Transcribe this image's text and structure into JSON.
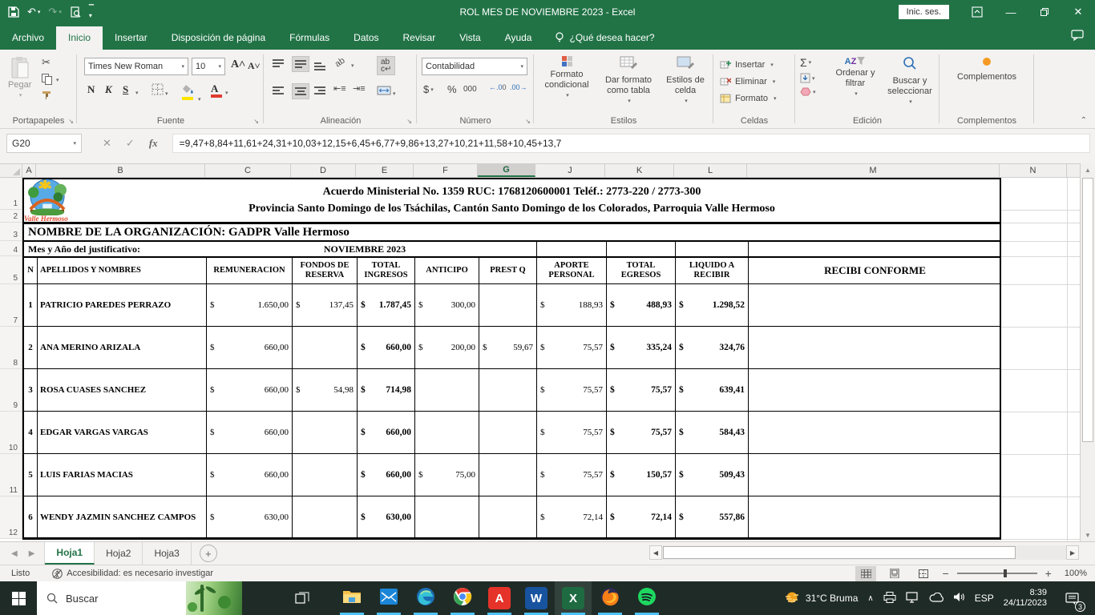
{
  "titlebar": {
    "title": "ROL MES DE NOVIEMBRE 2023  -  Excel",
    "sign_in": "Inic. ses."
  },
  "menu": {
    "tabs": [
      "Archivo",
      "Inicio",
      "Insertar",
      "Disposición de página",
      "Fórmulas",
      "Datos",
      "Revisar",
      "Vista",
      "Ayuda"
    ],
    "active_tab": "Inicio",
    "tell_me": "¿Qué desea hacer?"
  },
  "ribbon": {
    "paste_label": "Pegar",
    "clipboard_group": "Portapapeles",
    "font_name": "Times New Roman",
    "font_size": "10",
    "bold": "N",
    "italic": "K",
    "underline": "S",
    "font_group": "Fuente",
    "alignment_group": "Alineación",
    "number_format": "Contabilidad",
    "currency": "$",
    "percent": "%",
    "thousands": "000",
    "number_group": "Número",
    "conditional_format": "Formato condicional",
    "format_as_table": "Dar formato como tabla",
    "cell_styles": "Estilos de celda",
    "styles_group": "Estilos",
    "insert_label": "Insertar",
    "delete_label": "Eliminar",
    "format_label": "Formato",
    "cells_group": "Celdas",
    "sort_filter": "Ordenar y filtrar",
    "find_select": "Buscar y seleccionar",
    "editing_group": "Edición",
    "addins_button": "Complementos",
    "addins_group": "Complementos"
  },
  "formula_bar": {
    "cell_ref": "G20",
    "fx": "fx",
    "formula": "=9,47+8,84+11,61+24,31+10,03+12,15+6,45+6,77+9,86+13,27+10,21+11,58+10,45+13,7"
  },
  "sheet": {
    "columns": [
      "A",
      "B",
      "C",
      "D",
      "E",
      "F",
      "G",
      "J",
      "K",
      "L",
      "M",
      "N"
    ],
    "selected_column": "G",
    "row_numbers": [
      "1",
      "2",
      "3",
      "4",
      "5",
      "7",
      "8",
      "9",
      "10",
      "11",
      "12"
    ],
    "doc": {
      "line1": "Acuerdo Ministerial No. 1359 RUC: 1768120600001 Teléf.: 2773-220 / 2773-300",
      "line2": "Provincia Santo Domingo de los Tsáchilas, Cantón Santo Domingo de los Colorados, Parroquia Valle Hermoso",
      "org": "NOMBRE DE LA ORGANIZACIÓN: GADPR Valle Hermoso",
      "period_label": "Mes y Año del justificativo:",
      "period_value": "NOVIEMBRE 2023",
      "logo_caption": "Valle Hermoso"
    },
    "table": {
      "headers": [
        "N",
        "APELLIDOS Y NOMBRES",
        "REMUNERACION",
        "FONDOS DE RESERVA",
        "TOTAL INGRESOS",
        "ANTICIPO",
        "PREST Q",
        "APORTE PERSONAL",
        "TOTAL EGRESOS",
        "LIQUIDO A RECIBIR",
        "RECIBI CONFORME"
      ],
      "rows": [
        {
          "n": "1",
          "name": "PATRICIO PAREDES PERRAZO",
          "remuneracion": "1.650,00",
          "fondos": "137,45",
          "total_ingresos": "1.787,45",
          "anticipo": "300,00",
          "prest_q": "",
          "aporte": "188,93",
          "total_egresos": "488,93",
          "liquido": "1.298,52",
          "recibi": ""
        },
        {
          "n": "2",
          "name": "ANA MERINO ARIZALA",
          "remuneracion": "660,00",
          "fondos": "",
          "total_ingresos": "660,00",
          "anticipo": "200,00",
          "prest_q": "59,67",
          "aporte": "75,57",
          "total_egresos": "335,24",
          "liquido": "324,76",
          "recibi": ""
        },
        {
          "n": "3",
          "name": "ROSA CUASES SANCHEZ",
          "remuneracion": "660,00",
          "fondos": "54,98",
          "total_ingresos": "714,98",
          "anticipo": "",
          "prest_q": "",
          "aporte": "75,57",
          "total_egresos": "75,57",
          "liquido": "639,41",
          "recibi": ""
        },
        {
          "n": "4",
          "name": "EDGAR VARGAS VARGAS",
          "remuneracion": "660,00",
          "fondos": "",
          "total_ingresos": "660,00",
          "anticipo": "",
          "prest_q": "",
          "aporte": "75,57",
          "total_egresos": "75,57",
          "liquido": "584,43",
          "recibi": ""
        },
        {
          "n": "5",
          "name": "LUIS FARIAS MACIAS",
          "remuneracion": "660,00",
          "fondos": "",
          "total_ingresos": "660,00",
          "anticipo": "75,00",
          "prest_q": "",
          "aporte": "75,57",
          "total_egresos": "150,57",
          "liquido": "509,43",
          "recibi": ""
        },
        {
          "n": "6",
          "name": "WENDY JAZMIN SANCHEZ CAMPOS",
          "remuneracion": "630,00",
          "fondos": "",
          "total_ingresos": "630,00",
          "anticipo": "",
          "prest_q": "",
          "aporte": "72,14",
          "total_egresos": "72,14",
          "liquido": "557,86",
          "recibi": ""
        }
      ],
      "currency_symbol": "$"
    }
  },
  "sheet_tabs": {
    "tabs": [
      "Hoja1",
      "Hoja2",
      "Hoja3"
    ],
    "active": "Hoja1"
  },
  "status_bar": {
    "mode": "Listo",
    "accessibility": "Accesibilidad: es necesario investigar",
    "zoom": "100%"
  },
  "taskbar": {
    "search_placeholder": "Buscar",
    "weather": "31°C Bruma",
    "language": "ESP",
    "time": "8:39",
    "date": "24/11/2023",
    "notification_count": "3",
    "apps": [
      "explorer",
      "mail",
      "edge",
      "chrome",
      "acrobat",
      "word",
      "excel",
      "firefox",
      "spotify"
    ]
  },
  "colors": {
    "excel_green": "#217346",
    "taskbar_dark": "#1f2b27",
    "running_indicator": "#4cc2ff"
  }
}
